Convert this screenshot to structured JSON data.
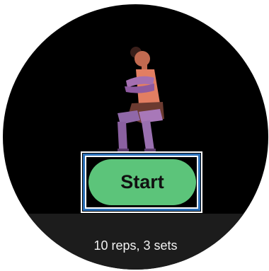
{
  "workout": {
    "start_label": "Start",
    "summary": "10 reps, 3 sets"
  },
  "colors": {
    "face": "#000000",
    "button": "#5cc47a",
    "focus_ring": "#2a6fb8",
    "panel": "#1c1c1c"
  },
  "icons": {
    "figure": "exercising-person-illustration"
  }
}
